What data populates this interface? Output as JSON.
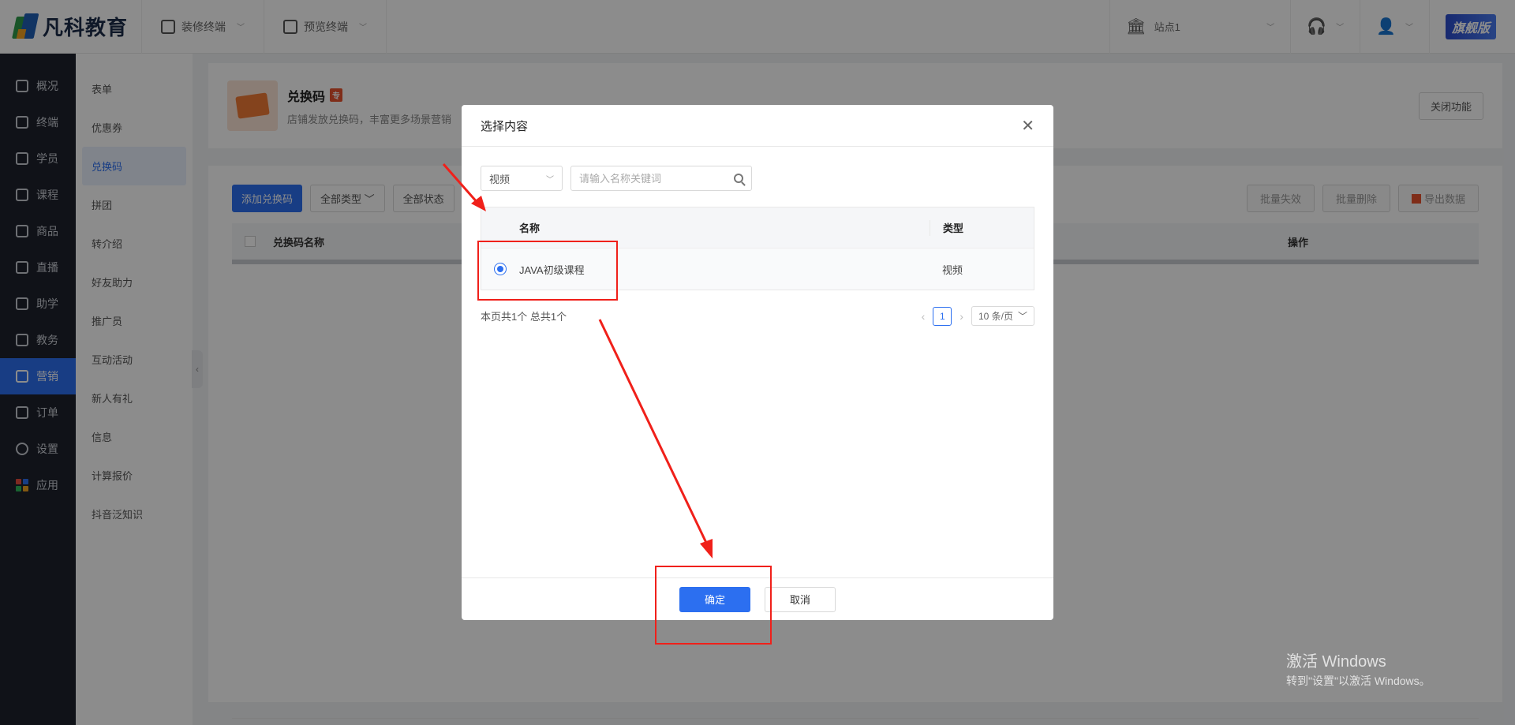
{
  "brand": {
    "name": "凡科教育"
  },
  "topbar": {
    "menus": [
      {
        "label": "装修终端",
        "icon": "paint-roller-icon"
      },
      {
        "label": "预览终端",
        "icon": "grid-icon"
      }
    ],
    "site": {
      "label": "站点1",
      "icon": "bank-icon"
    },
    "edition_badge": "旗舰版"
  },
  "nav": {
    "items": [
      {
        "label": "概况",
        "icon": "dashboard-icon"
      },
      {
        "label": "终端",
        "icon": "store-icon"
      },
      {
        "label": "学员",
        "icon": "users-icon"
      },
      {
        "label": "课程",
        "icon": "course-icon"
      },
      {
        "label": "商品",
        "icon": "product-icon"
      },
      {
        "label": "直播",
        "icon": "live-icon"
      },
      {
        "label": "助学",
        "icon": "study-icon"
      },
      {
        "label": "教务",
        "icon": "book-icon"
      },
      {
        "label": "营销",
        "icon": "marketing-icon",
        "active": true
      },
      {
        "label": "订单",
        "icon": "order-icon"
      },
      {
        "label": "设置",
        "icon": "settings-icon"
      },
      {
        "label": "应用",
        "icon": "apps-icon"
      }
    ]
  },
  "subnav": {
    "items": [
      "表单",
      "优惠券",
      "兑换码",
      "拼团",
      "转介绍",
      "好友助力",
      "推广员",
      "互动活动",
      "新人有礼",
      "信息",
      "计算报价",
      "抖音泛知识"
    ],
    "active_index": 2
  },
  "header": {
    "title": "兑换码",
    "pro_badge": "专",
    "desc": "店铺发放兑换码，丰富更多场景营销",
    "close_label": "关闭功能"
  },
  "list": {
    "add_label": "添加兑换码",
    "type_filter": "全部类型",
    "status_filter": "全部状态",
    "batch_invalid": "批量失效",
    "batch_delete": "批量删除",
    "export_label": "导出数据",
    "col_name": "兑换码名称",
    "col_op": "操作"
  },
  "modal": {
    "title": "选择内容",
    "type_select": "视频",
    "search_placeholder": "请输入名称关键词",
    "columns": {
      "name": "名称",
      "type": "类型"
    },
    "rows": [
      {
        "name": "JAVA初级课程",
        "type": "视频",
        "selected": true
      }
    ],
    "summary": "本页共1个 总共1个",
    "page": "1",
    "page_size": "10 条/页",
    "ok_label": "确定",
    "cancel_label": "取消"
  },
  "watermark": {
    "line1": "激活 Windows",
    "line2": "转到\"设置\"以激活 Windows。"
  },
  "colors": {
    "primary": "#2c6ff0",
    "annotation": "#f0201a",
    "sidebar": "#1e222d"
  }
}
